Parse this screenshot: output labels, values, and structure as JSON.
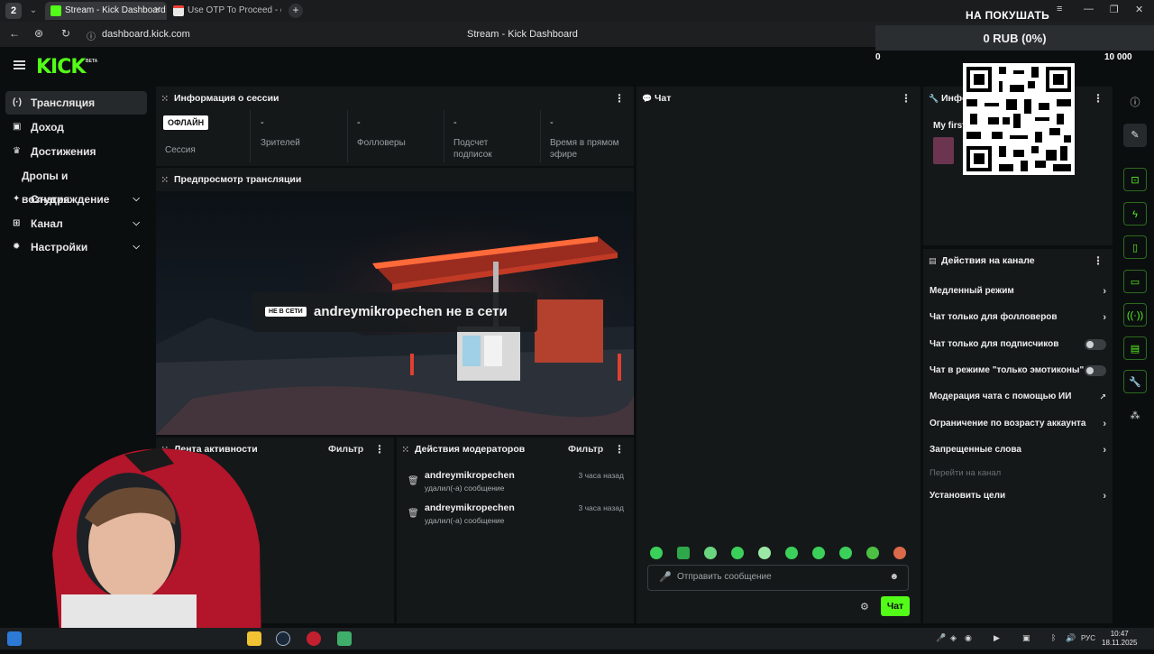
{
  "browser": {
    "tab_count": "2",
    "tabs": [
      {
        "title": "Stream - Kick Dashboard",
        "active": true
      },
      {
        "title": "Use OTP To Proceed - dev",
        "active": false
      }
    ],
    "url": "dashboard.kick.com",
    "page_title": "Stream - Kick Dashboard"
  },
  "overlay": {
    "goal_label": "НА ПОКУШАТЬ",
    "amount": "0 RUB (0%)",
    "goal_start": "0",
    "goal_end": "10 000"
  },
  "brand": {
    "logo": "KICK",
    "beta": "BETA",
    "accent": "#53fc18"
  },
  "sidebar": {
    "items": [
      {
        "label": "Трансляция",
        "icon": "broadcast-icon"
      },
      {
        "label": "Доход",
        "icon": "wallet-icon"
      },
      {
        "label": "Достижения",
        "icon": "trophy-icon"
      },
      {
        "label": "Дропы и вознаграждение",
        "icon": ""
      },
      {
        "label": "Студия",
        "icon": "studio-icon"
      },
      {
        "label": "Канал",
        "icon": "channel-icon"
      },
      {
        "label": "Настройки",
        "icon": "gear-icon"
      }
    ]
  },
  "session": {
    "title": "Информация о сессии",
    "status_badge": "ОФЛАЙН",
    "status_label": "Сессия",
    "stats": [
      {
        "value": "-",
        "label": "Зрителей"
      },
      {
        "value": "-",
        "label": "Фолловеры"
      },
      {
        "value": "-",
        "label": "Подсчет подписок"
      },
      {
        "value": "-",
        "label": "Время в прямом эфире"
      }
    ]
  },
  "preview": {
    "title": "Предпросмотр трансляции",
    "offline_badge": "НЕ В СЕТИ",
    "offline_text": "andreymikropechen не в сети"
  },
  "activity": {
    "title": "Лента активности",
    "filter": "Фильтр"
  },
  "mod_actions": {
    "title": "Действия модераторов",
    "filter": "Фильтр",
    "rows": [
      {
        "user": "andreymikropechen",
        "action": "удалил(-а) сообщение",
        "time": "3 часа назад"
      },
      {
        "user": "andreymikropechen",
        "action": "удалил(-а) сообщение",
        "time": "3 часа назад"
      }
    ]
  },
  "chat": {
    "title": "Чат",
    "placeholder": "Отправить сообщение",
    "send": "Чат"
  },
  "info_panel": {
    "title": "Информация о трансляции",
    "stream_title": "My first"
  },
  "channel_actions": {
    "title": "Действия на канале",
    "rows": [
      {
        "label": "Медленный режим",
        "control": "chevron"
      },
      {
        "label": "Чат только для фолловеров",
        "control": "chevron"
      },
      {
        "label": "Чат только для подписчиков",
        "control": "toggle"
      },
      {
        "label": "Чат в режиме \"только эмотиконы\"",
        "control": "toggle"
      },
      {
        "label": "Модерация чата с помощью ИИ",
        "control": "external"
      },
      {
        "label": "Ограничение по возрасту аккаунта",
        "control": "chevron"
      },
      {
        "label": "Запрещенные слова",
        "control": "chevron"
      },
      {
        "label": "Перейти на канал",
        "control": "none"
      },
      {
        "label": "Установить цели",
        "control": "chevron"
      }
    ]
  },
  "taskbar": {
    "lang": "РУС",
    "time": "10:47",
    "date": "18.11.2025"
  }
}
